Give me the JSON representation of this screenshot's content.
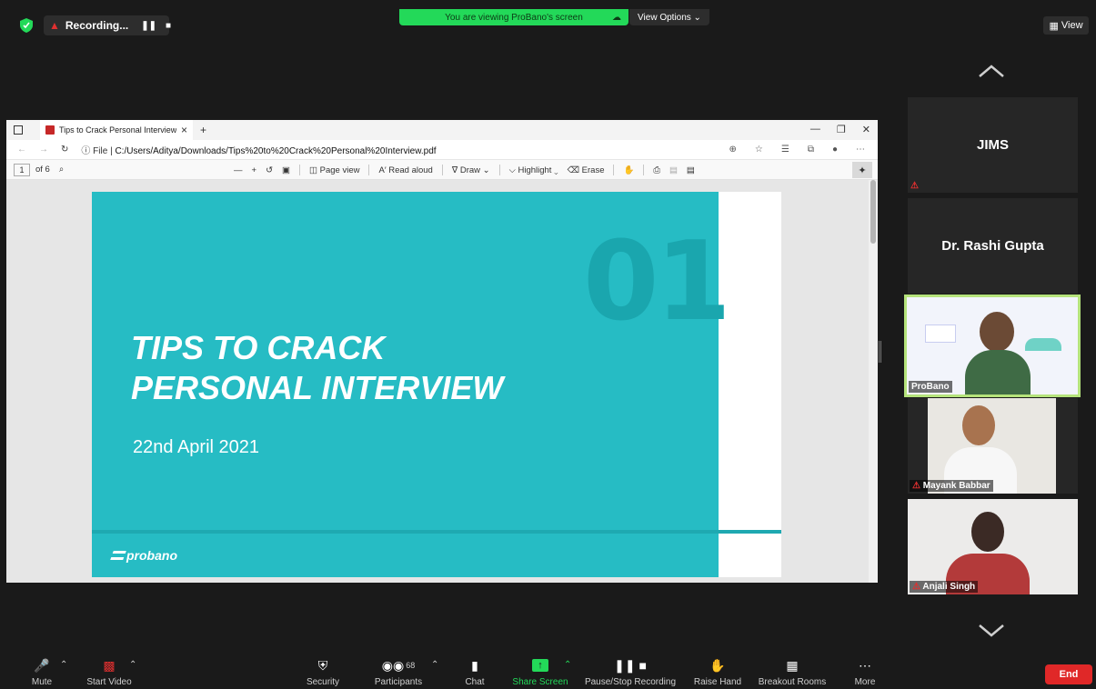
{
  "topbar": {
    "recording_label": "Recording...",
    "viewing_banner": "You are viewing ProBano's screen",
    "view_options_label": "View Options ⌄",
    "view_button_label": "View"
  },
  "browser": {
    "tab_title": "Tips to Crack Personal Interview",
    "address_prefix": "File",
    "address_url": "C:/Users/Aditya/Downloads/Tips%20to%20Crack%20Personal%20Interview.pdf"
  },
  "pdf_toolbar": {
    "page_current": "1",
    "page_total": "of 6",
    "page_view_label": "Page view",
    "read_aloud_label": "Read aloud",
    "draw_label": "Draw",
    "highlight_label": "Highlight",
    "erase_label": "Erase"
  },
  "slide": {
    "number": "01",
    "title_line1": "TIPS TO CRACK",
    "title_line2": "PERSONAL INTERVIEW",
    "date": "22nd April 2021",
    "logo_text": "probano"
  },
  "participants_panel": {
    "tiles": [
      {
        "name": "JIMS"
      },
      {
        "name": "Dr. Rashi Gupta"
      },
      {
        "name": "ProBano"
      },
      {
        "name": "Mayank Babbar"
      },
      {
        "name": "Anjali Singh"
      }
    ]
  },
  "bottom_bar": {
    "mute": "Mute",
    "start_video": "Start Video",
    "security": "Security",
    "participants": "Participants",
    "participant_count": "68",
    "chat": "Chat",
    "share_screen": "Share Screen",
    "pause_stop_recording": "Pause/Stop Recording",
    "raise_hand": "Raise Hand",
    "breakout_rooms": "Breakout Rooms",
    "more": "More",
    "end": "End"
  },
  "colors": {
    "share_green": "#23d959",
    "slide_teal": "#26bcc4",
    "end_red": "#e02828",
    "active_speaker_border": "#b5e37b"
  }
}
